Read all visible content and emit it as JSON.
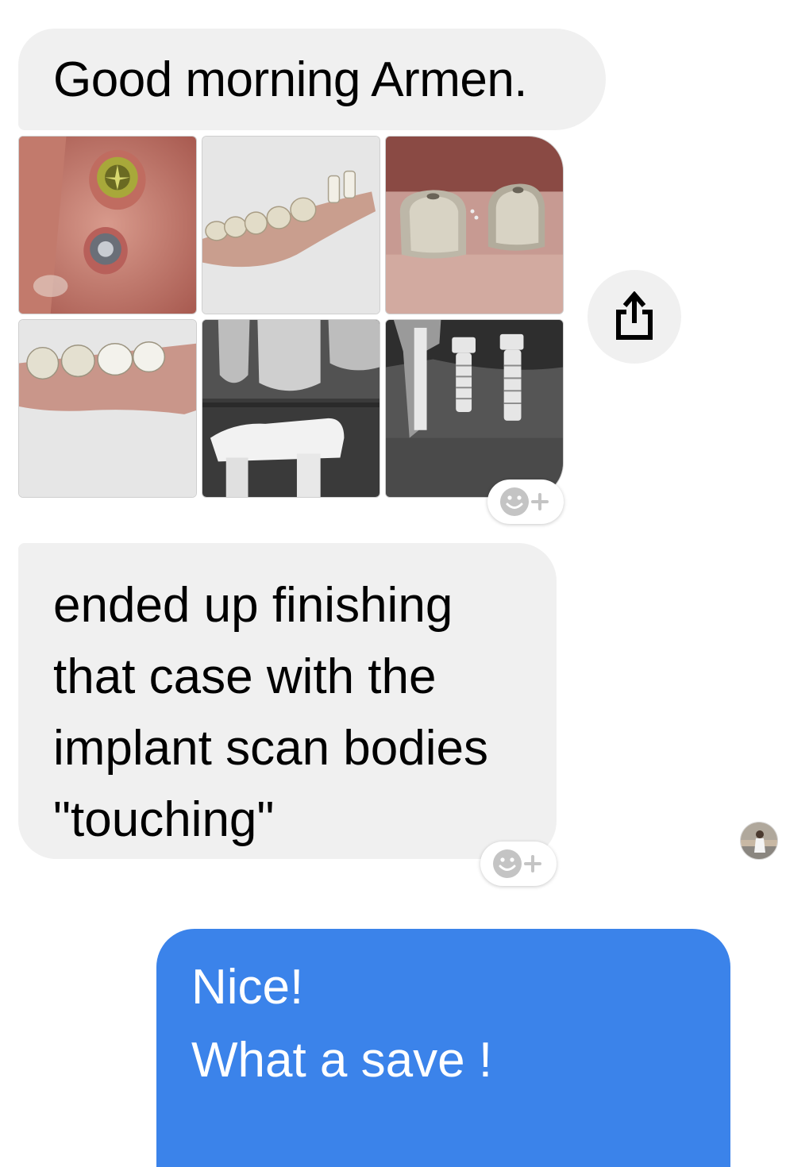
{
  "thread": {
    "received_greeting": "Good morning Armen.",
    "photos": [
      {
        "icon": "implant-abutments-photo-icon"
      },
      {
        "icon": "jaw-scan-model-icon"
      },
      {
        "icon": "scan-bodies-photo-icon"
      },
      {
        "icon": "crown-scan-model-icon"
      },
      {
        "icon": "bridge-xray-icon"
      },
      {
        "icon": "implant-xray-icon"
      }
    ],
    "received_message_lines": [
      "ended up finishing",
      "that case with the",
      "implant scan bodies",
      "\"touching\""
    ],
    "sent_message_lines": [
      "Nice!",
      "What a save !"
    ]
  },
  "actions": {
    "share_icon": "share-icon",
    "reaction_icon": "add-reaction-icon"
  },
  "colors": {
    "received_bubble": "#f0f0f0",
    "sent_bubble": "#3b83ea",
    "sent_text": "#ffffff",
    "reaction_icon": "#c4c4c4"
  }
}
